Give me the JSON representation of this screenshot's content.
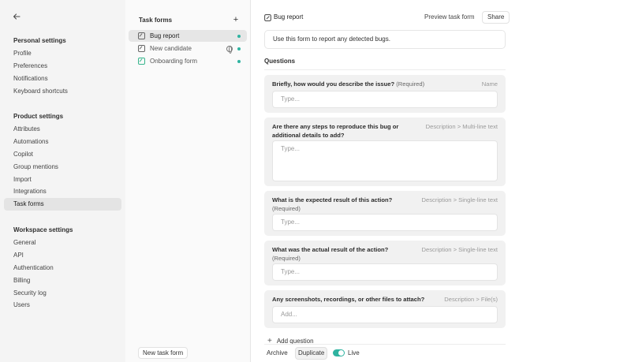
{
  "sidebar": {
    "back_icon": "arrow-left-icon",
    "sections": [
      {
        "title": "Personal settings",
        "items": [
          "Profile",
          "Preferences",
          "Notifications",
          "Keyboard shortcuts"
        ]
      },
      {
        "title": "Product settings",
        "items": [
          "Attributes",
          "Automations",
          "Copilot",
          "Group mentions",
          "Import",
          "Integrations",
          "Task forms"
        ]
      },
      {
        "title": "Workspace settings",
        "items": [
          "General",
          "API",
          "Authentication",
          "Billing",
          "Security log",
          "Users"
        ]
      }
    ],
    "active_item": "Task forms"
  },
  "forms_panel": {
    "title": "Task forms",
    "add_icon": "plus-icon",
    "forms": [
      {
        "label": "Bug report",
        "active": true,
        "public": false,
        "live": true
      },
      {
        "label": "New candidate",
        "active": false,
        "public": true,
        "live": true
      },
      {
        "label": "Onboarding form",
        "active": false,
        "public": false,
        "live": true
      }
    ],
    "new_button": "New task form"
  },
  "editor": {
    "title": "Bug report",
    "preview_button": "Preview task form",
    "share_button": "Share",
    "description": "Use this form to report any detected bugs.",
    "questions_heading": "Questions",
    "questions": [
      {
        "text": "Briefly, how would you describe the issue?",
        "required": "(Required)",
        "type": "Name",
        "placeholder": "Type..."
      },
      {
        "text": "Are there any steps to reproduce this bug or additional details to add?",
        "required": "",
        "type": "Description > Multi-line text",
        "placeholder": "Type..."
      },
      {
        "text": "What is the expected result of this action?",
        "required": "(Required)",
        "type": "Description > Single-line text",
        "placeholder": "Type..."
      },
      {
        "text": "What was the actual result of the action?",
        "required": "(Required)",
        "type": "Description > Single-line text",
        "placeholder": "Type..."
      },
      {
        "text": "Any screenshots, recordings, or other files to attach?",
        "required": "",
        "type": "Description > File(s)",
        "placeholder": "Add..."
      }
    ],
    "add_question": "Add question",
    "archive_button": "Archive",
    "duplicate_button": "Duplicate",
    "live_label": "Live",
    "live_on": true
  },
  "colors": {
    "accent": "#2fb3a0",
    "sidebar_bg": "#f4f4f4",
    "card_bg": "#f1f1f1"
  }
}
